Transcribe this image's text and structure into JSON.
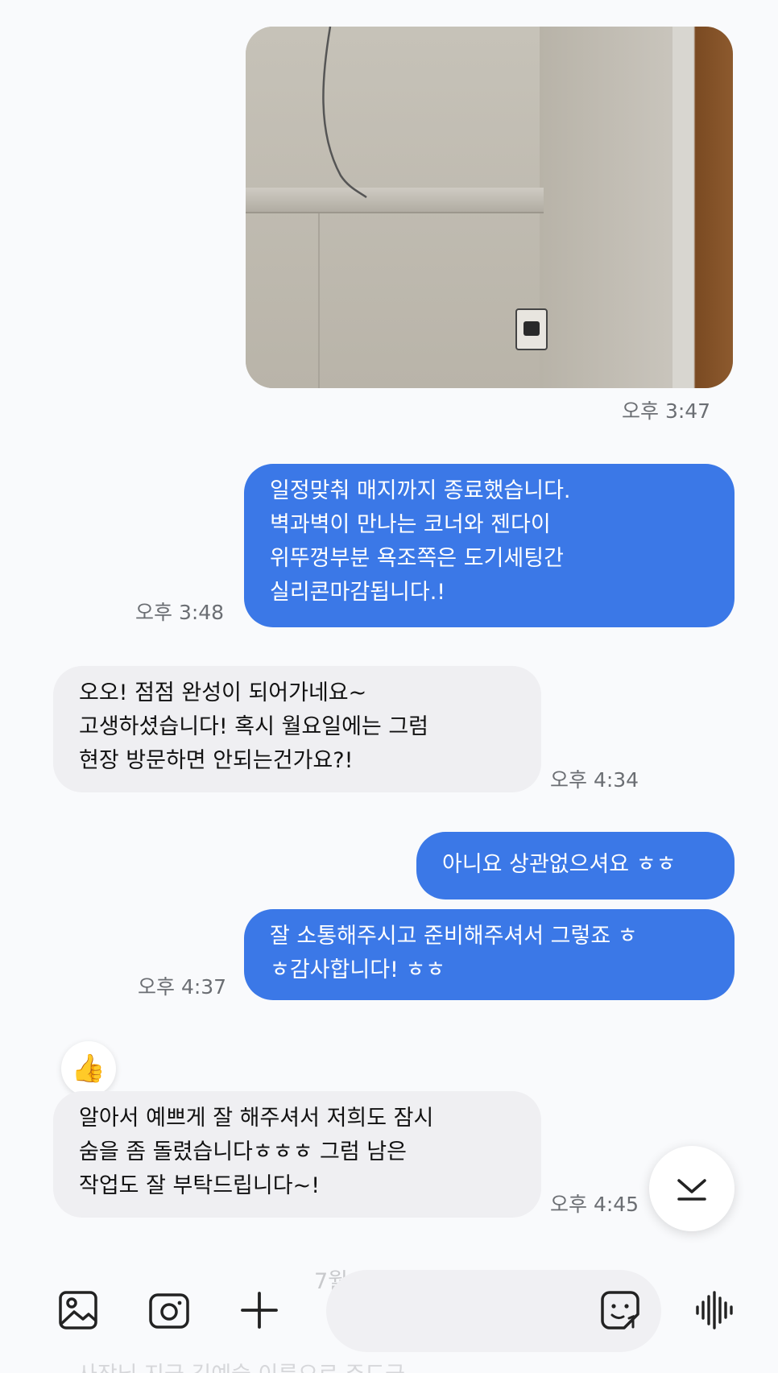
{
  "messages": [
    {
      "id": "photo",
      "type": "image",
      "side": "me",
      "time": "오후 3:47"
    },
    {
      "id": "m1",
      "side": "me",
      "text": "일정맞춰 매지까지 종료했습니다.\n벽과벽이 만나는 코너와 젠다이\n위뚜껑부분 욕조쪽은 도기세팅간\n실리콘마감됩니다.!",
      "time": "오후 3:48"
    },
    {
      "id": "m2",
      "side": "other",
      "text": "오오! 점점 완성이 되어가네요~\n고생하셨습니다! 혹시 월요일에는 그럼\n현장 방문하면 안되는건가요?!",
      "time": "오후 4:34"
    },
    {
      "id": "m3",
      "side": "me",
      "text": "아니요 상관없으셔요 ㅎㅎ",
      "time": ""
    },
    {
      "id": "m4",
      "side": "me",
      "text": "잘 소통해주시고 준비해주셔서 그렇죠 ㅎ\nㅎ감사합니다! ㅎㅎ",
      "time": "오후 4:37"
    },
    {
      "id": "m5",
      "side": "other",
      "text": "알아서 예쁘게 잘 해주셔서 저희도 잠시\n숨을 좀 돌렸습니다ㅎㅎㅎ  그럼 남은\n작업도 잘 부탁드립니다~!",
      "time": "오후 4:45",
      "reaction": "👍"
    }
  ],
  "faded": {
    "date_partial": "7월",
    "preview_partial": "사장님 지금 김예슬 이름으로 주도급"
  },
  "icons": {
    "reaction": "thumbs-up-icon",
    "scroll": "chevron-down-icon",
    "gallery": "image-icon",
    "camera": "camera-icon",
    "plus": "plus-icon",
    "sticker": "sticker-icon",
    "voice": "voice-wave-icon"
  },
  "colors": {
    "my_bubble": "#3b78e7",
    "other_bubble": "#efeff2",
    "timestamp": "#6b6e73",
    "background": "#f9fafc"
  }
}
